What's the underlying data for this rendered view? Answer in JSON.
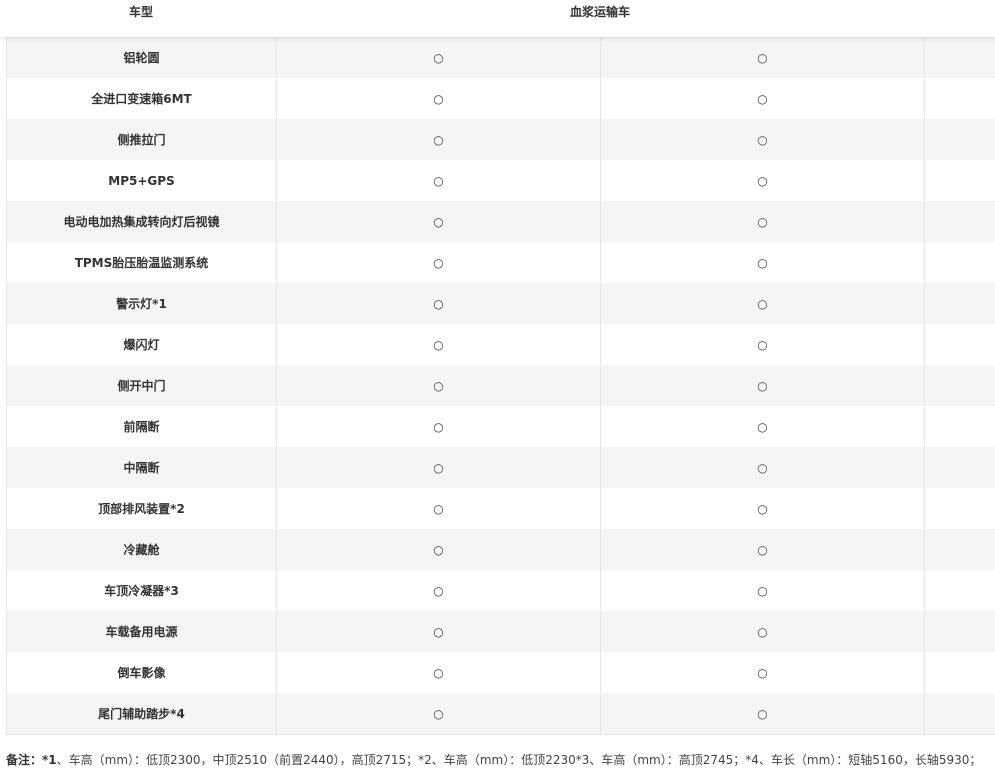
{
  "header": {
    "model_label": "车型",
    "vehicle_label": "血浆运输车"
  },
  "mark_symbol": "○",
  "rows": [
    {
      "feature": "铝轮圆",
      "col1": "○",
      "col2": "○"
    },
    {
      "feature": "全进口变速箱6MT",
      "col1": "○",
      "col2": "○"
    },
    {
      "feature": "侧推拉门",
      "col1": "○",
      "col2": "○"
    },
    {
      "feature": "MP5+GPS",
      "col1": "○",
      "col2": "○"
    },
    {
      "feature": "电动电加热集成转向灯后视镜",
      "col1": "○",
      "col2": "○"
    },
    {
      "feature": "TPMS胎压胎温监测系统",
      "col1": "○",
      "col2": "○"
    },
    {
      "feature": "警示灯*1",
      "col1": "○",
      "col2": "○"
    },
    {
      "feature": "爆闪灯",
      "col1": "○",
      "col2": "○"
    },
    {
      "feature": "侧开中门",
      "col1": "○",
      "col2": "○"
    },
    {
      "feature": "前隔断",
      "col1": "○",
      "col2": "○"
    },
    {
      "feature": "中隔断",
      "col1": "○",
      "col2": "○"
    },
    {
      "feature": "顶部排风装置*2",
      "col1": "○",
      "col2": "○"
    },
    {
      "feature": "冷藏舱",
      "col1": "○",
      "col2": "○"
    },
    {
      "feature": "车顶冷凝器*3",
      "col1": "○",
      "col2": "○"
    },
    {
      "feature": "车载备用电源",
      "col1": "○",
      "col2": "○"
    },
    {
      "feature": "倒车影像",
      "col1": "○",
      "col2": "○"
    },
    {
      "feature": "尾门辅助踏步*4",
      "col1": "○",
      "col2": "○"
    }
  ],
  "note": {
    "label": "备注：*1",
    "text": "、车高（mm）：低顶2300，中顶2510（前置2440），高顶2715；*2、车高（mm）：低顶2230*3、车高（mm）：高顶2745；*4、车长（mm）：短轴5160，长轴5930；"
  }
}
